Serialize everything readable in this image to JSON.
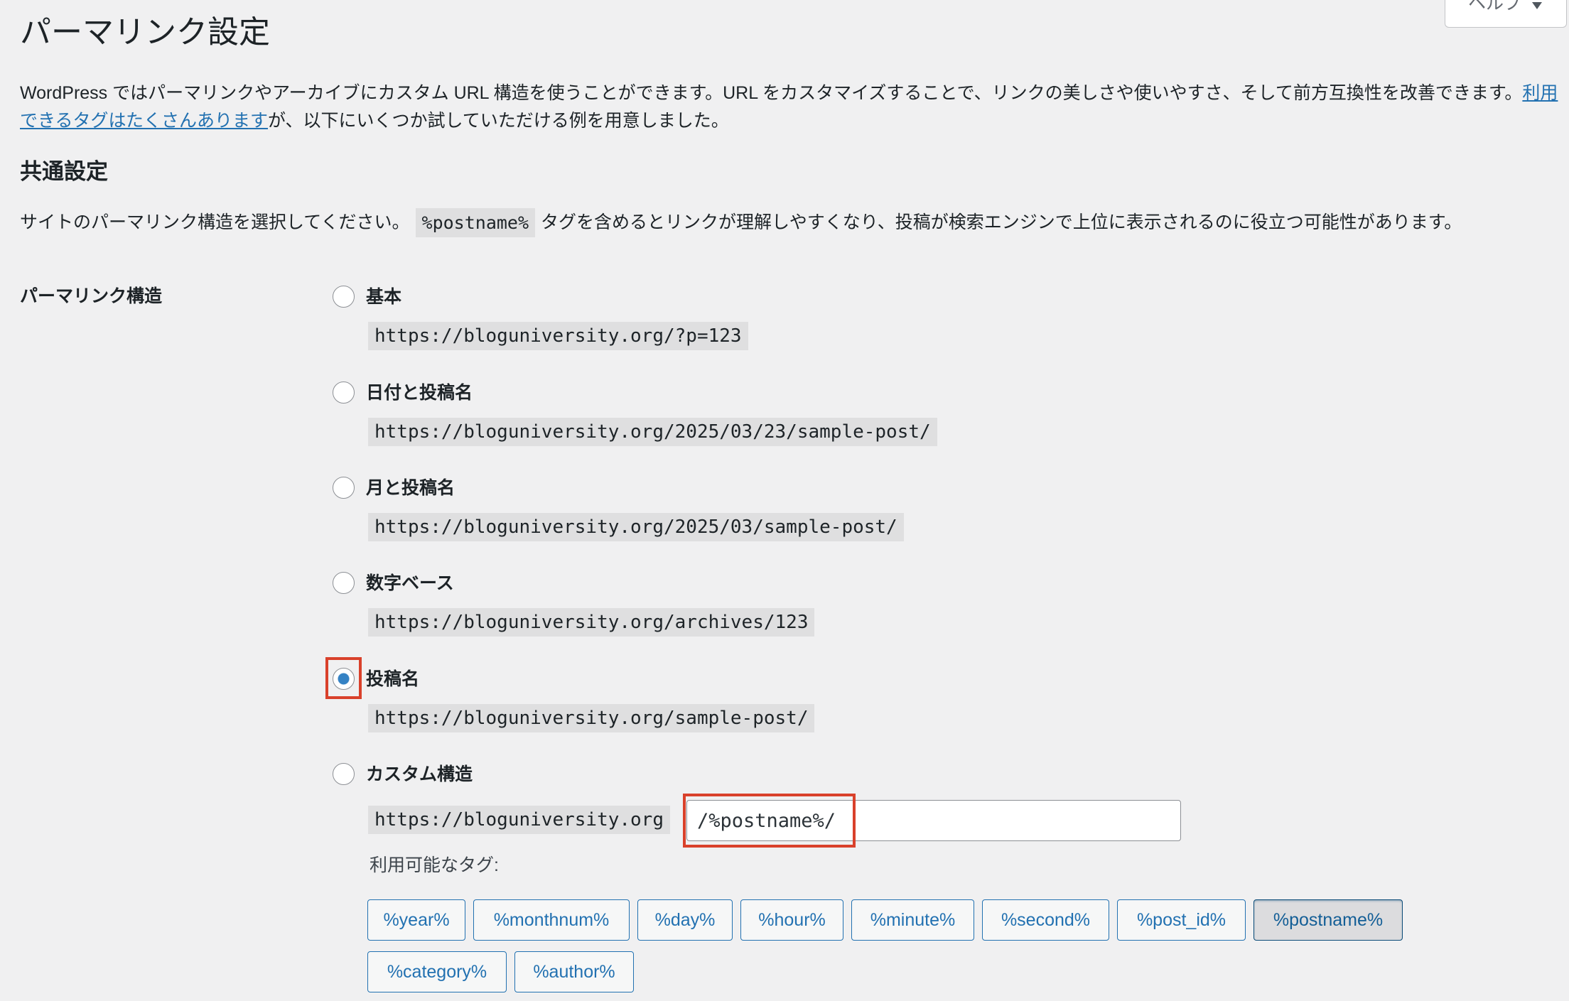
{
  "page": {
    "title": "パーマリンク設定",
    "help": {
      "label": "ヘルプ",
      "icon": "chevron-down-icon"
    }
  },
  "intro": {
    "text_before_link": "WordPress ではパーマリンクやアーカイブにカスタム URL 構造を使うことができます。URL をカスタマイズすることで、リンクの美しさや使いやすさ、そして前方互換性を改善できます。",
    "link": "利用できるタグはたくさんあります",
    "text_after_link": "が、以下にいくつか試していただける例を用意しました。"
  },
  "common_settings": {
    "heading": "共通設定",
    "description_before": "サイトのパーマリンク構造を選択してください。",
    "description_code": "%postname%",
    "description_after": "タグを含めるとリンクが理解しやすくなり、投稿が検索エンジンで上位に表示されるのに役立つ可能性があります。"
  },
  "permalink_structure": {
    "label": "パーマリンク構造",
    "options": [
      {
        "label": "基本",
        "example": "https://bloguniversity.org/?p=123",
        "checked": false
      },
      {
        "label": "日付と投稿名",
        "example": "https://bloguniversity.org/2025/03/23/sample-post/",
        "checked": false
      },
      {
        "label": "月と投稿名",
        "example": "https://bloguniversity.org/2025/03/sample-post/",
        "checked": false
      },
      {
        "label": "数字ベース",
        "example": "https://bloguniversity.org/archives/123",
        "checked": false
      },
      {
        "label": "投稿名",
        "example": "https://bloguniversity.org/sample-post/",
        "checked": true
      }
    ],
    "custom": {
      "label": "カスタム構造",
      "checked": false,
      "base_url": "https://bloguniversity.org",
      "value": "/%postname%/",
      "available_tags_label": "利用可能なタグ:",
      "tags": [
        {
          "label": "%year%",
          "pressed": false
        },
        {
          "label": "%monthnum%",
          "pressed": false
        },
        {
          "label": "%day%",
          "pressed": false
        },
        {
          "label": "%hour%",
          "pressed": false
        },
        {
          "label": "%minute%",
          "pressed": false
        },
        {
          "label": "%second%",
          "pressed": false
        },
        {
          "label": "%post_id%",
          "pressed": false
        },
        {
          "label": "%postname%",
          "pressed": true
        },
        {
          "label": "%category%",
          "pressed": false
        },
        {
          "label": "%author%",
          "pressed": false
        }
      ]
    }
  },
  "colors": {
    "accent": "#2271b1",
    "highlight": "#d9412b",
    "background": "#f0f0f1"
  }
}
